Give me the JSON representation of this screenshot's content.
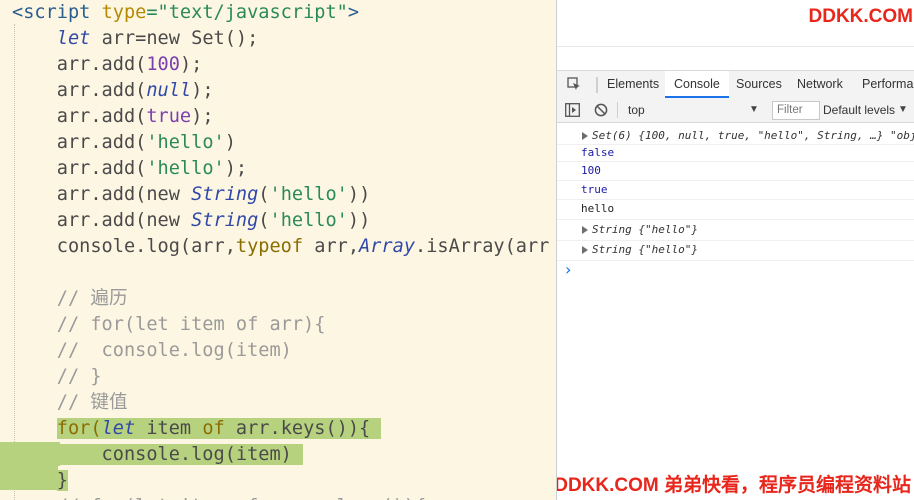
{
  "editor": {
    "lines": [
      {
        "tokens": [
          {
            "t": "<script ",
            "c": "k-tag"
          },
          {
            "t": "type",
            "c": "k-attr"
          },
          {
            "t": "=\"text/javascript\"",
            "c": "k-str"
          },
          {
            "t": ">",
            "c": "k-tag"
          }
        ]
      },
      {
        "tokens": [
          {
            "t": "    "
          },
          {
            "t": "let",
            "c": "k-it"
          },
          {
            "t": " arr=new Set();"
          }
        ]
      },
      {
        "tokens": [
          {
            "t": "    arr.add("
          },
          {
            "t": "100",
            "c": "k-num"
          },
          {
            "t": ");"
          }
        ]
      },
      {
        "tokens": [
          {
            "t": "    arr.add("
          },
          {
            "t": "null",
            "c": "k-it"
          },
          {
            "t": ");"
          }
        ]
      },
      {
        "tokens": [
          {
            "t": "    arr.add("
          },
          {
            "t": "true",
            "c": "k-num"
          },
          {
            "t": ");"
          }
        ]
      },
      {
        "tokens": [
          {
            "t": "    arr.add("
          },
          {
            "t": "'hello'",
            "c": "k-str"
          },
          {
            "t": ")"
          }
        ]
      },
      {
        "tokens": [
          {
            "t": "    arr.add("
          },
          {
            "t": "'hello'",
            "c": "k-str"
          },
          {
            "t": ");"
          }
        ]
      },
      {
        "tokens": [
          {
            "t": "    arr.add(new "
          },
          {
            "t": "String",
            "c": "k-it"
          },
          {
            "t": "("
          },
          {
            "t": "'hello'",
            "c": "k-str"
          },
          {
            "t": "))"
          }
        ]
      },
      {
        "tokens": [
          {
            "t": "    arr.add(new "
          },
          {
            "t": "String",
            "c": "k-it"
          },
          {
            "t": "("
          },
          {
            "t": "'hello'",
            "c": "k-str"
          },
          {
            "t": "))"
          }
        ]
      },
      {
        "tokens": [
          {
            "t": "    console.log(arr,"
          },
          {
            "t": "typeof",
            "c": "k-kw"
          },
          {
            "t": " arr,"
          },
          {
            "t": "Array",
            "c": "k-it"
          },
          {
            "t": ".isArray(arr"
          }
        ]
      },
      {
        "tokens": [
          {
            "t": ""
          }
        ]
      },
      {
        "tokens": [
          {
            "t": "    "
          },
          {
            "t": "// 遍历",
            "c": "k-cmt"
          }
        ]
      },
      {
        "tokens": [
          {
            "t": "    "
          },
          {
            "t": "// for(let item of arr){",
            "c": "k-cmt"
          }
        ]
      },
      {
        "tokens": [
          {
            "t": "    "
          },
          {
            "t": "//  console.log(item)",
            "c": "k-cmt"
          }
        ]
      },
      {
        "tokens": [
          {
            "t": "    "
          },
          {
            "t": "// }",
            "c": "k-cmt"
          }
        ]
      },
      {
        "tokens": [
          {
            "t": "    "
          },
          {
            "t": "// 键值",
            "c": "k-cmt"
          }
        ]
      },
      {
        "hl": "a",
        "tokens": [
          {
            "t": "    "
          },
          {
            "t": "for(",
            "c": "k-kw",
            "h": 1
          },
          {
            "t": "let",
            "c": "k-it",
            "h": 1
          },
          {
            "t": " item ",
            "h": 1
          },
          {
            "t": "of",
            "c": "k-kw",
            "h": 1
          },
          {
            "t": " arr.keys()){ ",
            "h": 1
          }
        ]
      },
      {
        "hl": "b",
        "tokens": [
          {
            "t": "        console.log(item) ",
            "h": 1
          }
        ]
      },
      {
        "hl": "c",
        "tokens": [
          {
            "t": "    "
          },
          {
            "t": "}",
            "h": 1
          }
        ]
      },
      {
        "tokens": [
          {
            "t": "    "
          },
          {
            "t": "// for(let item of arr.values()){",
            "c": "k-cmt"
          }
        ]
      }
    ]
  },
  "devtools": {
    "watermark_top": "DDKK.COM",
    "tabs": [
      "Elements",
      "Console",
      "Sources",
      "Network",
      "Performan"
    ],
    "active_tab": "Console",
    "context": "top",
    "filter_placeholder": "Filter",
    "levels": "Default levels",
    "log": [
      {
        "kind": "expand",
        "text": "Set(6) {100, null, true, \"hello\", String, …} \"obj",
        "color": "#333"
      },
      {
        "kind": "plain",
        "text": "false",
        "color": "#1a1aa6"
      },
      {
        "kind": "plain",
        "text": "100",
        "color": "#1a1aa6"
      },
      {
        "kind": "plain",
        "text": "true",
        "color": "#1a1aa6"
      },
      {
        "kind": "plain",
        "text": "hello",
        "color": "#222"
      },
      {
        "kind": "expand",
        "text": "String {\"hello\"}",
        "color": "#333"
      },
      {
        "kind": "expand",
        "text": "String {\"hello\"}",
        "color": "#333"
      }
    ],
    "prompt": "›",
    "watermark_bottom": "DDKK.COM 弟弟快看，程序员编程资料站"
  }
}
